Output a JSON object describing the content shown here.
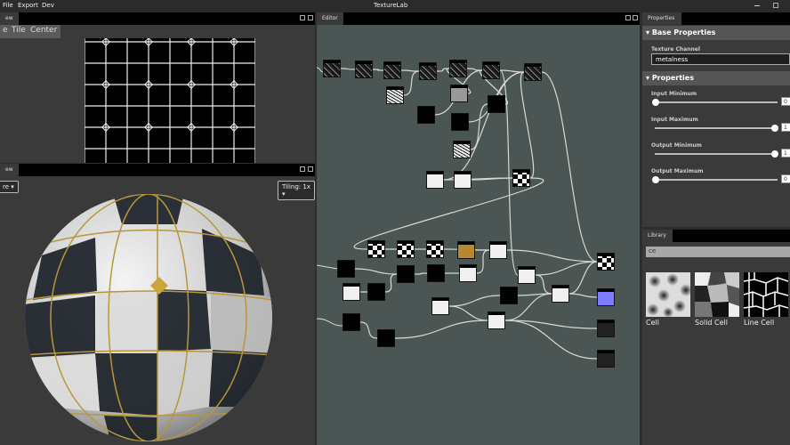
{
  "window": {
    "title": "TextureLab",
    "menu": [
      "File",
      "Export",
      "Dev"
    ]
  },
  "preview2d": {
    "tab": "ew",
    "buttons": [
      "e",
      "Tile",
      "Center"
    ]
  },
  "preview3d": {
    "tab": "ew",
    "mode_dropdown": "re",
    "tiling_dropdown": "Tiling: 1x"
  },
  "editor": {
    "tab": "Editor",
    "background": "#4b5553"
  },
  "properties": {
    "tab": "Properties",
    "base_section": "Base Properties",
    "texture_channel_label": "Texture Channel",
    "texture_channel_value": "metalness",
    "props_section": "Properties",
    "sliders": [
      {
        "label": "Input Minimum",
        "value": "0",
        "fraction": 0
      },
      {
        "label": "Input Maximum",
        "value": "1",
        "fraction": 1
      },
      {
        "label": "Output Minimum",
        "value": "1",
        "fraction": 1
      },
      {
        "label": "Output Maximum",
        "value": "0",
        "fraction": 0
      }
    ]
  },
  "library": {
    "tab": "Library",
    "search_value": "ce",
    "items": [
      {
        "label": "Cell",
        "icon": "cell-noise-thumbnail"
      },
      {
        "label": "Solid Cell",
        "icon": "solid-cell-thumbnail"
      },
      {
        "label": "Line Cell",
        "icon": "line-cell-thumbnail"
      }
    ]
  },
  "colors": {
    "accent_gold": "#c9a53a",
    "normal_blue": "#7c7cff"
  }
}
